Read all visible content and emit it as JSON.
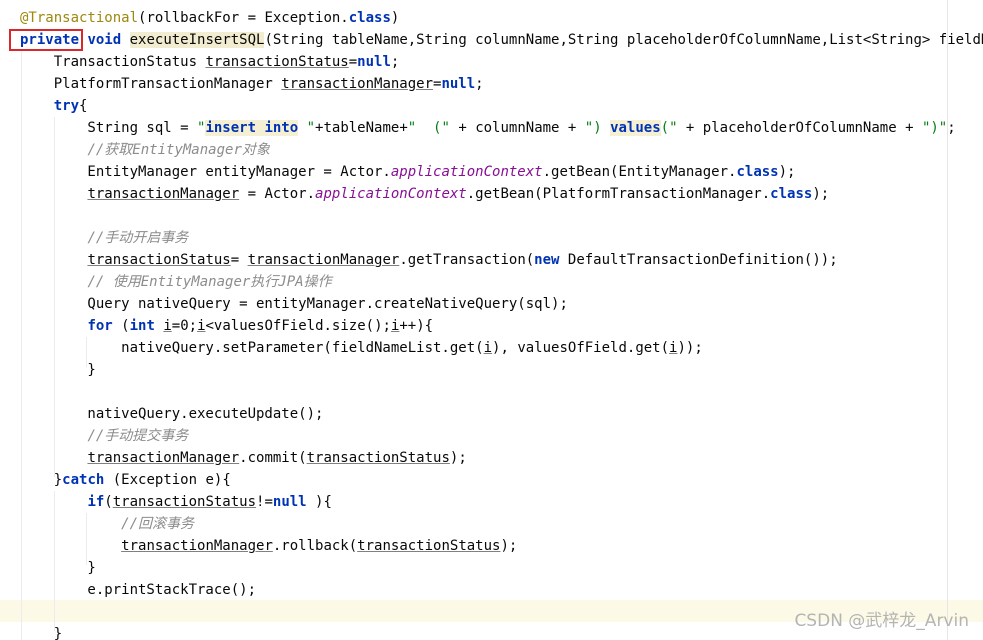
{
  "editor": {
    "lines": [
      {
        "tokens": [
          {
            "t": "@Transactional",
            "c": "ann"
          },
          {
            "t": "(rollbackFor = Exception."
          },
          {
            "t": "class",
            "c": "kw"
          },
          {
            "t": ")"
          }
        ]
      },
      {
        "tokens": [
          {
            "t": "private",
            "c": "kw"
          },
          {
            "t": " "
          },
          {
            "t": "void",
            "c": "kw"
          },
          {
            "t": " "
          },
          {
            "t": "executeInsertSQL",
            "c": "hl"
          },
          {
            "t": "(String tableName,String columnName,String placeholderOfColumnName,List<String> fieldNameList"
          }
        ]
      },
      {
        "tokens": [
          {
            "t": "    TransactionStatus "
          },
          {
            "t": "transactionStatus",
            "c": "ul"
          },
          {
            "t": "="
          },
          {
            "t": "null",
            "c": "kw"
          },
          {
            "t": ";"
          }
        ]
      },
      {
        "tokens": [
          {
            "t": "    PlatformTransactionManager "
          },
          {
            "t": "transactionManager",
            "c": "ul"
          },
          {
            "t": "="
          },
          {
            "t": "null",
            "c": "kw"
          },
          {
            "t": ";"
          }
        ]
      },
      {
        "tokens": [
          {
            "t": "    "
          },
          {
            "t": "try",
            "c": "kw"
          },
          {
            "t": "{"
          }
        ]
      },
      {
        "tokens": [
          {
            "t": "        String sql = "
          },
          {
            "t": "\"",
            "c": "str"
          },
          {
            "t": "insert into",
            "c": "ph"
          },
          {
            "t": " \"",
            "c": "str"
          },
          {
            "t": "+tableName+"
          },
          {
            "t": "\"  (\"",
            "c": "str"
          },
          {
            "t": " + columnName + "
          },
          {
            "t": "\")",
            "c": "str"
          },
          {
            "t": " "
          },
          {
            "t": "values",
            "c": "ph"
          },
          {
            "t": "(\"",
            "c": "str"
          },
          {
            "t": " + placeholderOfColumnName + "
          },
          {
            "t": "\")\"",
            "c": "str"
          },
          {
            "t": ";"
          }
        ]
      },
      {
        "tokens": [
          {
            "t": "        "
          },
          {
            "t": "//获取EntityManager对象",
            "c": "cmt"
          }
        ]
      },
      {
        "tokens": [
          {
            "t": "        EntityManager entityManager = Actor."
          },
          {
            "t": "applicationContext",
            "c": "fld"
          },
          {
            "t": ".getBean(EntityManager."
          },
          {
            "t": "class",
            "c": "kw"
          },
          {
            "t": ");"
          }
        ]
      },
      {
        "tokens": [
          {
            "t": "        "
          },
          {
            "t": "transactionManager",
            "c": "ul"
          },
          {
            "t": " = Actor."
          },
          {
            "t": "applicationContext",
            "c": "fld"
          },
          {
            "t": ".getBean(PlatformTransactionManager."
          },
          {
            "t": "class",
            "c": "kw"
          },
          {
            "t": ");"
          }
        ]
      },
      {
        "tokens": []
      },
      {
        "tokens": [
          {
            "t": "        "
          },
          {
            "t": "//手动开启事务",
            "c": "cmt"
          }
        ]
      },
      {
        "tokens": [
          {
            "t": "        "
          },
          {
            "t": "transactionStatus",
            "c": "ul"
          },
          {
            "t": "= "
          },
          {
            "t": "transactionManager",
            "c": "ul"
          },
          {
            "t": ".getTransaction("
          },
          {
            "t": "new",
            "c": "kw"
          },
          {
            "t": " DefaultTransactionDefinition());"
          }
        ]
      },
      {
        "tokens": [
          {
            "t": "        "
          },
          {
            "t": "// 使用EntityManager执行JPA操作",
            "c": "cmt"
          }
        ]
      },
      {
        "tokens": [
          {
            "t": "        Query nativeQuery = entityManager.createNativeQuery(sql);"
          }
        ]
      },
      {
        "tokens": [
          {
            "t": "        "
          },
          {
            "t": "for",
            "c": "kw"
          },
          {
            "t": " ("
          },
          {
            "t": "int",
            "c": "kw"
          },
          {
            "t": " "
          },
          {
            "t": "i",
            "c": "ul"
          },
          {
            "t": "=0;"
          },
          {
            "t": "i",
            "c": "ul"
          },
          {
            "t": "<valuesOfField.size();"
          },
          {
            "t": "i",
            "c": "ul"
          },
          {
            "t": "++){"
          }
        ]
      },
      {
        "tokens": [
          {
            "t": "            nativeQuery.setParameter(fieldNameList.get("
          },
          {
            "t": "i",
            "c": "ul"
          },
          {
            "t": "), valuesOfField.get("
          },
          {
            "t": "i",
            "c": "ul"
          },
          {
            "t": "));"
          }
        ]
      },
      {
        "tokens": [
          {
            "t": "        }"
          }
        ]
      },
      {
        "tokens": []
      },
      {
        "tokens": [
          {
            "t": "        nativeQuery.executeUpdate();"
          }
        ]
      },
      {
        "tokens": [
          {
            "t": "        "
          },
          {
            "t": "//手动提交事务",
            "c": "cmt"
          }
        ]
      },
      {
        "tokens": [
          {
            "t": "        "
          },
          {
            "t": "transactionManager",
            "c": "ul"
          },
          {
            "t": ".commit("
          },
          {
            "t": "transactionStatus",
            "c": "ul"
          },
          {
            "t": ");"
          }
        ]
      },
      {
        "tokens": [
          {
            "t": "    }"
          },
          {
            "t": "catch",
            "c": "kw"
          },
          {
            "t": " (Exception e){"
          }
        ]
      },
      {
        "tokens": [
          {
            "t": "        "
          },
          {
            "t": "if",
            "c": "kw"
          },
          {
            "t": "("
          },
          {
            "t": "transactionStatus",
            "c": "ul"
          },
          {
            "t": "!="
          },
          {
            "t": "null",
            "c": "kw"
          },
          {
            "t": " ){"
          }
        ]
      },
      {
        "tokens": [
          {
            "t": "            "
          },
          {
            "t": "//回滚事务",
            "c": "cmt"
          }
        ]
      },
      {
        "tokens": [
          {
            "t": "            "
          },
          {
            "t": "transactionManager",
            "c": "ul"
          },
          {
            "t": ".rollback("
          },
          {
            "t": "transactionStatus",
            "c": "ul"
          },
          {
            "t": ");"
          }
        ]
      },
      {
        "tokens": [
          {
            "t": "        }"
          }
        ]
      },
      {
        "tokens": [
          {
            "t": "        e.printStackTrace();"
          }
        ]
      },
      {
        "tokens": []
      },
      {
        "tokens": [
          {
            "t": "    }"
          }
        ]
      }
    ]
  },
  "highlight_box": {
    "label": "private",
    "color": "#d9282c"
  },
  "watermark": "CSDN @武梓龙_Arvin"
}
